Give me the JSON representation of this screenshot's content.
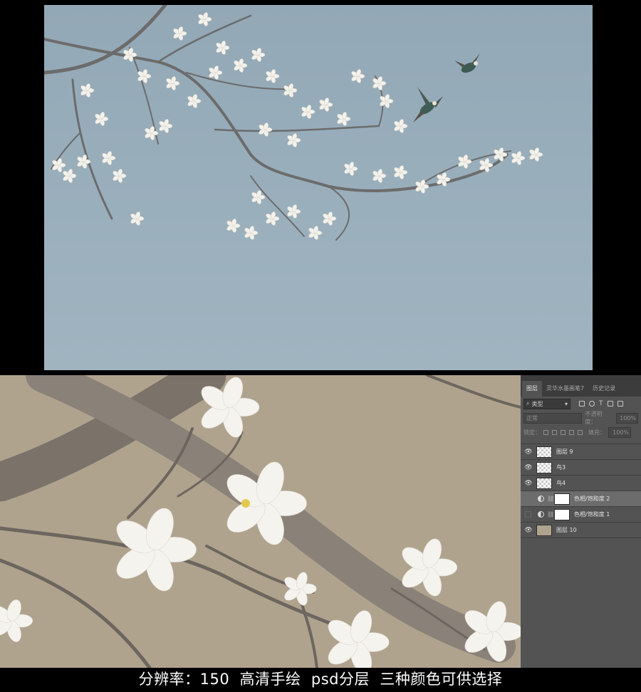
{
  "panel": {
    "tabs": [
      {
        "label": "图层"
      },
      {
        "label": "灵华水墨画笔7"
      },
      {
        "label": "历史记录"
      }
    ],
    "filter_kind": "类型",
    "blend_mode": "正常",
    "opacity_label": "不透明度：",
    "opacity_value": "100%",
    "lock_label": "锁定：",
    "fill_label": "填充：",
    "fill_value": "100%",
    "layers": [
      {
        "name": "图层 9",
        "visible": true,
        "kind": "pixel"
      },
      {
        "name": "鸟3",
        "visible": true,
        "kind": "pixel"
      },
      {
        "name": "鸟4",
        "visible": true,
        "kind": "pixel"
      },
      {
        "name": "色相/饱和度 2",
        "visible": false,
        "kind": "adjustment",
        "selected": true
      },
      {
        "name": "色相/饱和度 1",
        "visible": false,
        "kind": "adjustment"
      },
      {
        "name": "图层 10",
        "visible": true,
        "kind": "fill"
      }
    ]
  },
  "caption": "分辨率：150  高清手绘  psd分层  三种颜色可供选择",
  "colors": {
    "top_background": "#97acb9",
    "closeup_background": "#b0a38e",
    "panel_background": "#535353"
  }
}
